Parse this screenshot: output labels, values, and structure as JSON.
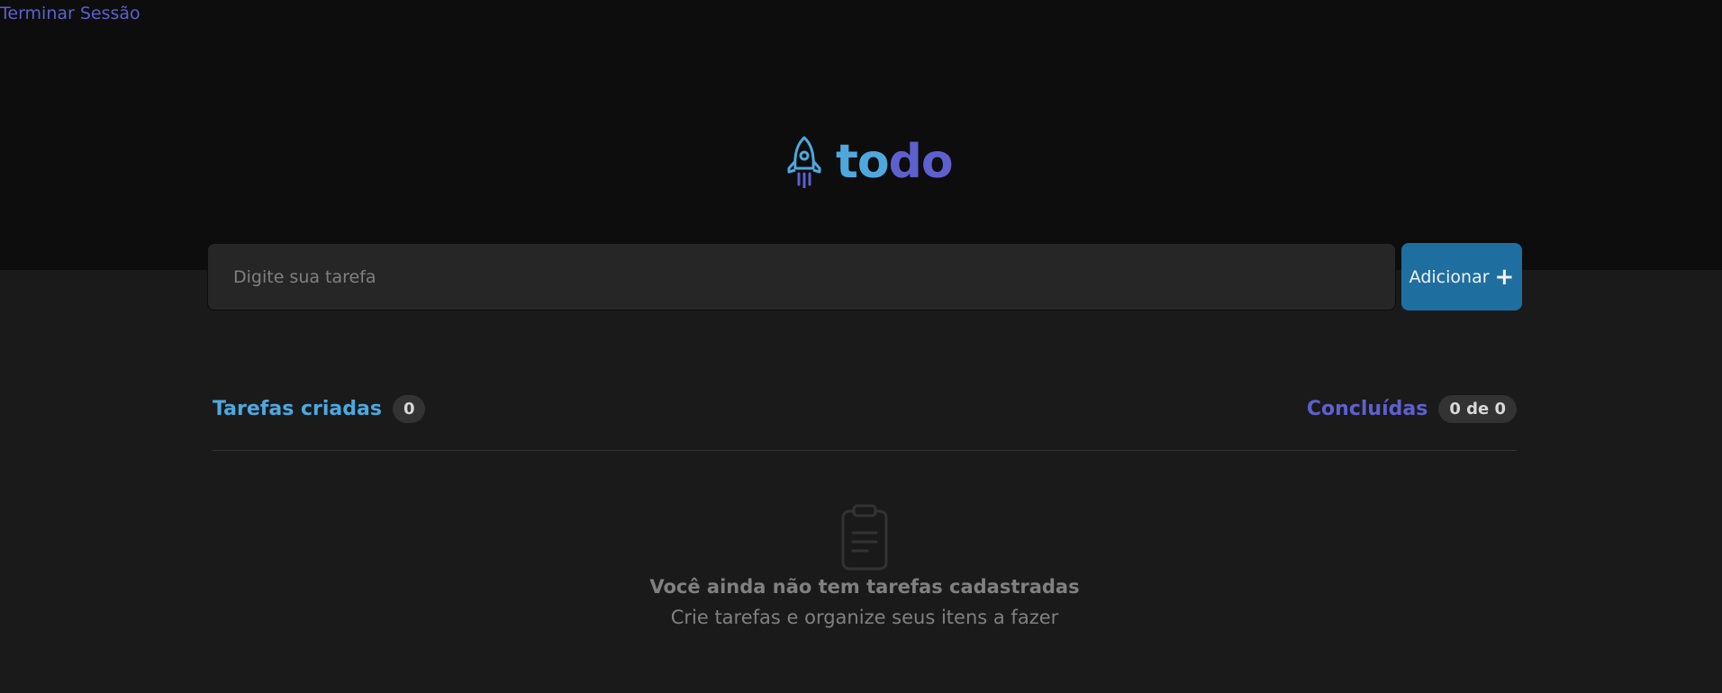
{
  "header": {
    "logout_label": "Terminar Sessão",
    "logo": {
      "icon": "rocket-icon",
      "text_part1": "to",
      "text_part2": "do"
    }
  },
  "task_form": {
    "input_placeholder": "Digite sua tarefa",
    "input_value": "",
    "add_button_label": "Adicionar",
    "add_button_icon": "plus-icon"
  },
  "counters": {
    "created_label": "Tarefas criadas",
    "created_count": "0",
    "done_label": "Concluídas",
    "done_count": "0 de 0"
  },
  "empty_state": {
    "icon": "clipboard-icon",
    "title": "Você ainda não tem tarefas cadastradas",
    "subtitle": "Crie tarefas e organize seus itens a fazer"
  },
  "colors": {
    "background": "#1a1a1a",
    "header_background": "#0d0d0d",
    "blue": "#4ea8de",
    "purple": "#5e60ce",
    "button": "#1e6f9f",
    "input_background": "#262626",
    "badge_background": "#333333",
    "muted_text": "#808080"
  }
}
